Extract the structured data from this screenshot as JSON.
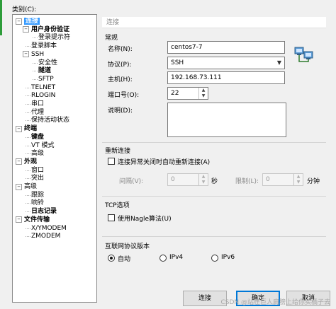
{
  "dialog": {
    "category_label": "类别(C):"
  },
  "tree": [
    {
      "label": "连接",
      "level": 0,
      "expander": "−",
      "selected": true,
      "bold": true
    },
    {
      "label": "用户身份验证",
      "level": 1,
      "expander": "−",
      "bold": true
    },
    {
      "label": "登录提示符",
      "level": 2
    },
    {
      "label": "登录脚本",
      "level": 1
    },
    {
      "label": "SSH",
      "level": 1,
      "expander": "−"
    },
    {
      "label": "安全性",
      "level": 2
    },
    {
      "label": "隧道",
      "level": 2,
      "bold": true
    },
    {
      "label": "SFTP",
      "level": 2
    },
    {
      "label": "TELNET",
      "level": 1
    },
    {
      "label": "RLOGIN",
      "level": 1
    },
    {
      "label": "串口",
      "level": 1
    },
    {
      "label": "代理",
      "level": 1
    },
    {
      "label": "保持活动状态",
      "level": 1
    },
    {
      "label": "终端",
      "level": 0,
      "expander": "−",
      "bold": true
    },
    {
      "label": "键盘",
      "level": 1,
      "bold": true
    },
    {
      "label": "VT 模式",
      "level": 1
    },
    {
      "label": "高级",
      "level": 1
    },
    {
      "label": "外观",
      "level": 0,
      "expander": "−",
      "bold": true
    },
    {
      "label": "窗口",
      "level": 1
    },
    {
      "label": "突出",
      "level": 1
    },
    {
      "label": "高级",
      "level": 0,
      "expander": "−"
    },
    {
      "label": "跟踪",
      "level": 1
    },
    {
      "label": "响铃",
      "level": 1
    },
    {
      "label": "日志记录",
      "level": 1,
      "bold": true
    },
    {
      "label": "文件传输",
      "level": 0,
      "expander": "−",
      "bold": true
    },
    {
      "label": "X/YMODEM",
      "level": 1
    },
    {
      "label": "ZMODEM",
      "level": 1
    }
  ],
  "header": {
    "title": "连接"
  },
  "general": {
    "title": "常规",
    "name_label": "名称(N):",
    "name_value": "centos7-7",
    "protocol_label": "协议(P):",
    "protocol_value": "SSH",
    "host_label": "主机(H):",
    "host_value": "192.168.73.111",
    "port_label": "端口号(O):",
    "port_value": "22",
    "desc_label": "说明(D):"
  },
  "reconnect": {
    "title": "重新连接",
    "checkbox_label": "连接异常关闭时自动重新连接(A)",
    "interval_label": "间隔(V):",
    "interval_value": "0",
    "interval_unit": "秒",
    "limit_label": "限制(L):",
    "limit_value": "0",
    "limit_unit": "分钟"
  },
  "tcp": {
    "title": "TCP选项",
    "nagle_label": "使用Nagle算法(U)"
  },
  "ip": {
    "title": "互联网协议版本",
    "options": [
      {
        "label": "自动",
        "checked": true
      },
      {
        "label": "IPv4",
        "checked": false
      },
      {
        "label": "IPv6",
        "checked": false
      }
    ]
  },
  "buttons": {
    "connect": "连接",
    "ok": "确定",
    "cancel": "取消"
  },
  "watermark": "CSDN @站在巨人肩膀上给你买橘子去"
}
